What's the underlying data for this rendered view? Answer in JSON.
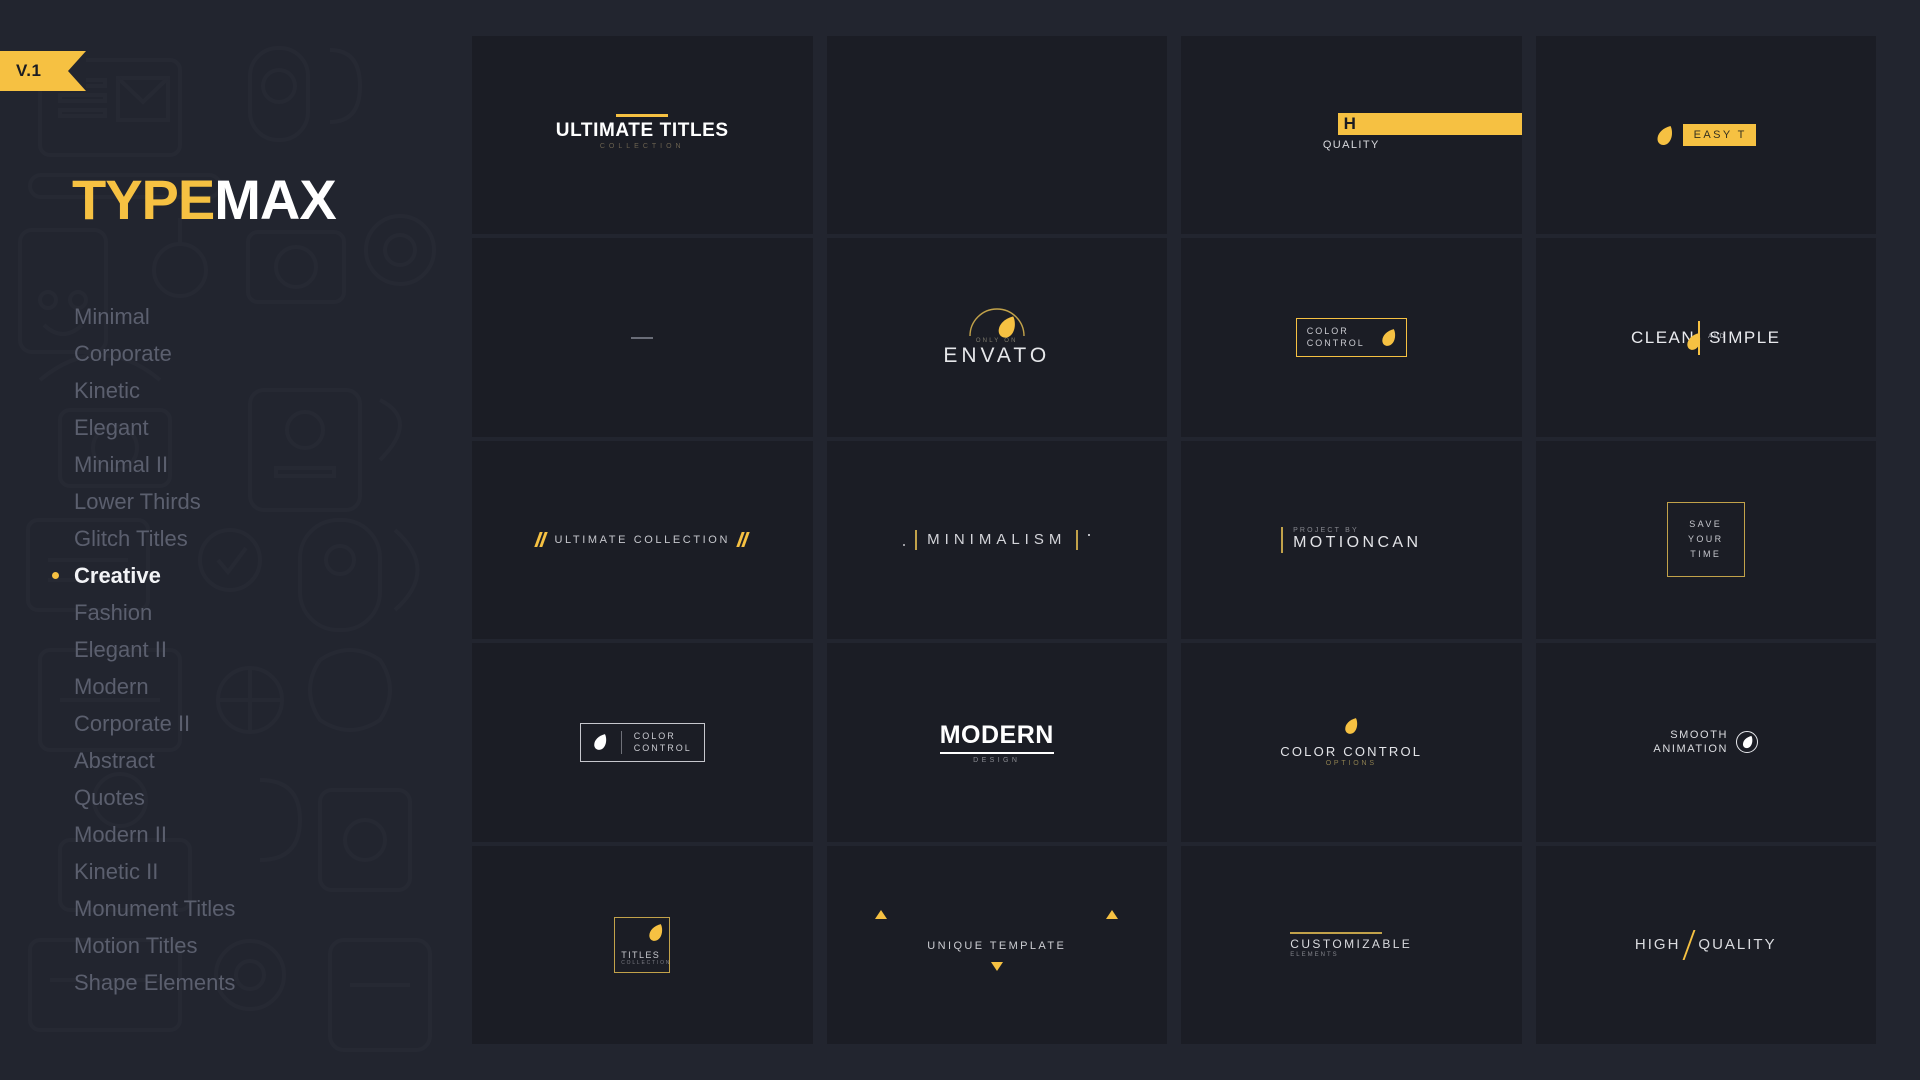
{
  "brand": {
    "version_badge": "V.1",
    "logo_part1": "TYPE",
    "logo_part2": "MAX",
    "accent_color": "#f6c142",
    "background_color": "#22252f",
    "tile_color": "#1b1d25"
  },
  "sidebar": {
    "items": [
      {
        "label": "Minimal",
        "active": false
      },
      {
        "label": "Corporate",
        "active": false
      },
      {
        "label": "Kinetic",
        "active": false
      },
      {
        "label": "Elegant",
        "active": false
      },
      {
        "label": "Minimal II",
        "active": false
      },
      {
        "label": "Lower Thirds",
        "active": false
      },
      {
        "label": "Glitch Titles",
        "active": false
      },
      {
        "label": "Creative",
        "active": true
      },
      {
        "label": "Fashion",
        "active": false
      },
      {
        "label": "Elegant II",
        "active": false
      },
      {
        "label": "Modern",
        "active": false
      },
      {
        "label": "Corporate II",
        "active": false
      },
      {
        "label": "Abstract",
        "active": false
      },
      {
        "label": "Quotes",
        "active": false
      },
      {
        "label": "Modern II",
        "active": false
      },
      {
        "label": "Kinetic II",
        "active": false
      },
      {
        "label": "Monument Titles",
        "active": false
      },
      {
        "label": "Motion Titles",
        "active": false
      },
      {
        "label": "Shape Elements",
        "active": false
      }
    ]
  },
  "grid": {
    "tiles": [
      {
        "id": "ultimate-titles",
        "title": "ULTIMATE TITLES",
        "subtitle": "COLLECTION"
      },
      {
        "id": "blank-1",
        "title": "",
        "subtitle": ""
      },
      {
        "id": "high-quality",
        "title": "H",
        "subtitle": "QUALITY"
      },
      {
        "id": "easy-to-use",
        "title": "EASY T",
        "subtitle": ""
      },
      {
        "id": "dash",
        "title": "",
        "subtitle": ""
      },
      {
        "id": "only-on-envato",
        "title": "ENVATO",
        "subtitle": "ONLY ON"
      },
      {
        "id": "color-control-yellow",
        "line1": "COLOR",
        "line2": "CONTROL"
      },
      {
        "id": "clean-and-simple",
        "word1": "CLEAN",
        "word2": "SIMPLE",
        "connector": "AND"
      },
      {
        "id": "ultimate-collection",
        "title": "ULTIMATE COLLECTION"
      },
      {
        "id": "minimalism",
        "title": "MINIMALISM"
      },
      {
        "id": "project-by-motioncan",
        "title": "MOTIONCAN",
        "subtitle": "PROJECT BY"
      },
      {
        "id": "save-your-time",
        "line1": "SAVE",
        "line2": "YOUR",
        "line3": "TIME"
      },
      {
        "id": "color-control-white",
        "line1": "COLOR",
        "line2": "CONTROL"
      },
      {
        "id": "modern-design",
        "title": "MODERN",
        "subtitle": "DESIGN"
      },
      {
        "id": "color-control-options",
        "title": "COLOR CONTROL",
        "subtitle": "OPTIONS"
      },
      {
        "id": "smooth-animation",
        "line1": "SMOOTH",
        "line2": "ANIMATION"
      },
      {
        "id": "titles-collection",
        "line1": "TITLES",
        "line2": "COLLECTION"
      },
      {
        "id": "unique-template",
        "title": "UNIQUE TEMPLATE"
      },
      {
        "id": "customizable-elements",
        "title": "CUSTOMIZABLE",
        "subtitle": "ELEMENTS"
      },
      {
        "id": "high-quality-2",
        "word1": "HIGH",
        "word2": "QUALITY"
      }
    ]
  }
}
